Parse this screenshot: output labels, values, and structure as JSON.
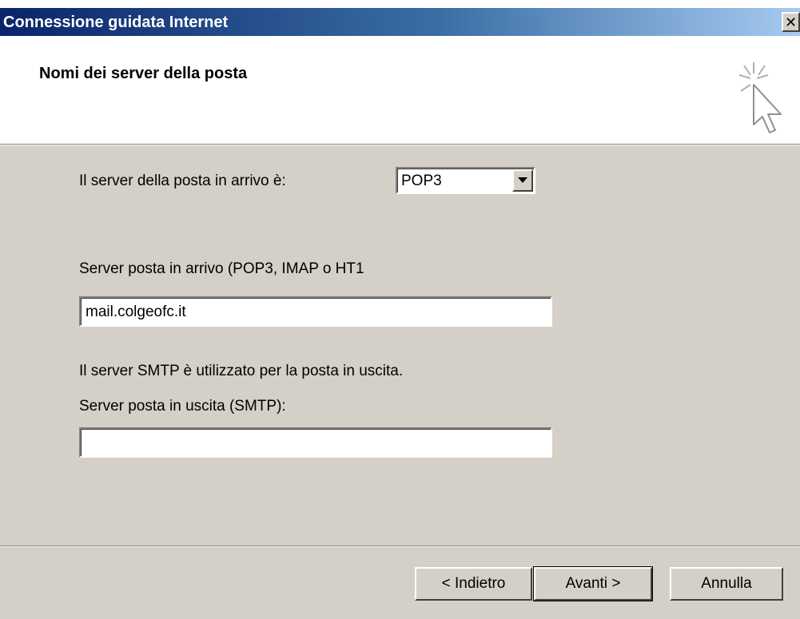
{
  "window": {
    "title": "Connessione guidata Internet",
    "close_symbol": "✕"
  },
  "header": {
    "title": "Nomi dei server della posta",
    "icon": "wizard-cursor-sparkle-icon"
  },
  "form": {
    "incoming_type_label": "Il server della posta in arrivo è:",
    "incoming_type_value": "POP3",
    "incoming_server_label": "Server posta in arrivo (POP3, IMAP o HT1",
    "incoming_server_value": "mail.colgeofc.it",
    "smtp_note": "Il server SMTP è utilizzato per la posta in uscita.",
    "outgoing_server_label": "Server posta in uscita (SMTP):",
    "outgoing_server_value": ""
  },
  "buttons": {
    "back": "< Indietro",
    "next": "Avanti >",
    "cancel": "Annulla"
  },
  "colors": {
    "titlebar_start": "#0a246a",
    "titlebar_end": "#a6caf0",
    "dialog_bg": "#d4d0c8",
    "header_bg": "#ffffff"
  }
}
